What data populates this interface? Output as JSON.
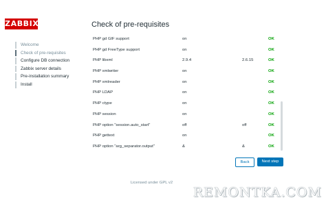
{
  "app": {
    "logo_text": "ZABBIX"
  },
  "sidebar": {
    "steps": [
      {
        "label": "Welcome",
        "state": "done"
      },
      {
        "label": "Check of pre-requisites",
        "state": "current"
      },
      {
        "label": "Configure DB connection",
        "state": "pending"
      },
      {
        "label": "Zabbix server details",
        "state": "pending"
      },
      {
        "label": "Pre-installation summary",
        "state": "pending"
      },
      {
        "label": "Install",
        "state": "pending"
      }
    ]
  },
  "main": {
    "title": "Check of pre-requisites",
    "rows": [
      {
        "name": "PHP gd GIF support",
        "current": "on",
        "required": "",
        "result": "OK"
      },
      {
        "name": "PHP gd FreeType support",
        "current": "on",
        "required": "",
        "result": "OK"
      },
      {
        "name": "PHP libxml",
        "current": "2.9.4",
        "required": "2.6.15",
        "result": "OK"
      },
      {
        "name": "PHP xmlwriter",
        "current": "on",
        "required": "",
        "result": "OK"
      },
      {
        "name": "PHP xmlreader",
        "current": "on",
        "required": "",
        "result": "OK"
      },
      {
        "name": "PHP LDAP",
        "current": "on",
        "required": "",
        "result": "OK"
      },
      {
        "name": "PHP ctype",
        "current": "on",
        "required": "",
        "result": "OK"
      },
      {
        "name": "PHP session",
        "current": "on",
        "required": "",
        "result": "OK"
      },
      {
        "name": "PHP option \"session.auto_start\"",
        "current": "off",
        "required": "off",
        "result": "OK"
      },
      {
        "name": "PHP gettext",
        "current": "on",
        "required": "",
        "result": "OK"
      },
      {
        "name": "PHP option \"arg_separator.output\"",
        "current": "&",
        "required": "&",
        "result": "OK"
      }
    ],
    "scroll_position": 0.58
  },
  "buttons": {
    "back": "Back",
    "next": "Next step"
  },
  "footer": {
    "license": "Licensed under GPL v2"
  },
  "watermark": "REMONTKA.COM",
  "colors": {
    "brand": "#d40000",
    "accent": "#0275b8",
    "ok": "#00a000",
    "muted": "#768d99"
  }
}
